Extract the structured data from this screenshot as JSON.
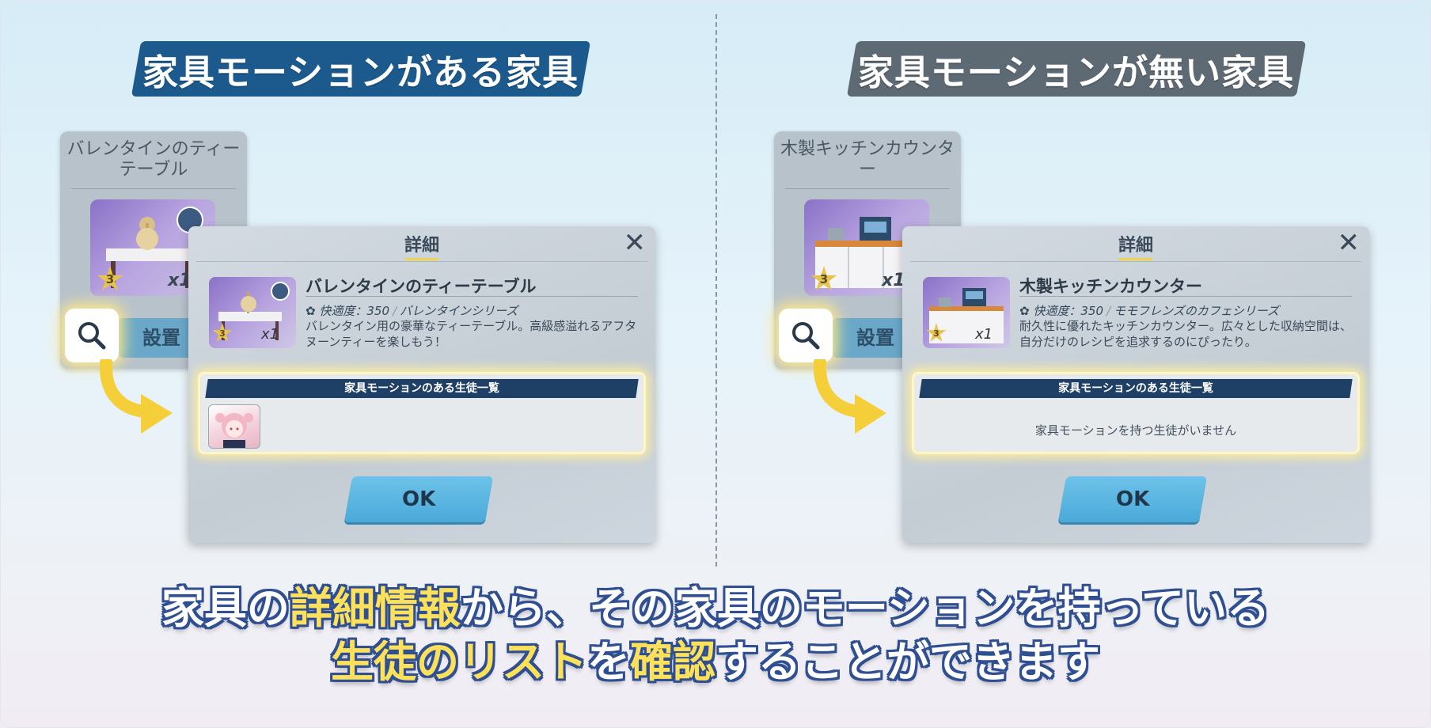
{
  "colors": {
    "banner_with": "#1c5a8e",
    "banner_without": "#5d6973",
    "highlight": "#fde15a",
    "ok_button": "#5bb6e1"
  },
  "left": {
    "banner": "家具モーションがある家具",
    "card": {
      "title": "バレンタインのティーテーブル",
      "rank": "3",
      "qty": "x1",
      "button": "設置"
    },
    "dialog": {
      "header": "詳細",
      "item_name": "バレンタインのティーテーブル",
      "comfort": "快適度：350",
      "series": "バレンタインシリーズ",
      "description": "バレンタイン用の豪華なティーテーブル。高級感溢れるアフタヌーンティーを楽しもう！",
      "rank": "3",
      "qty": "x1",
      "list_header": "家具モーションのある生徒一覧",
      "ok": "OK"
    }
  },
  "right": {
    "banner": "家具モーションが無い家具",
    "card": {
      "title": "木製キッチンカウンター",
      "rank": "3",
      "qty": "x1",
      "button": "設置"
    },
    "dialog": {
      "header": "詳細",
      "item_name": "木製キッチンカウンター",
      "comfort": "快適度：350",
      "series": "モモフレンズのカフェシリーズ",
      "description": "耐久性に優れたキッチンカウンター。広々とした収納空間は、自分だけのレシピを追求するのにぴったり。",
      "rank": "3",
      "qty": "x1",
      "list_header": "家具モーションのある生徒一覧",
      "empty_message": "家具モーションを持つ生徒がいません",
      "ok": "OK"
    }
  },
  "caption": {
    "line1_a": "家具の",
    "line1_hl": "詳細情報",
    "line1_b": "から、その家具のモーションを持っている",
    "line2_hl1": "生徒のリスト",
    "line2_a": "を",
    "line2_hl2": "確認",
    "line2_b": "することができます"
  },
  "icons": {
    "search": "magnifier-icon",
    "close": "close-icon",
    "arrow": "curved-arrow-icon"
  }
}
